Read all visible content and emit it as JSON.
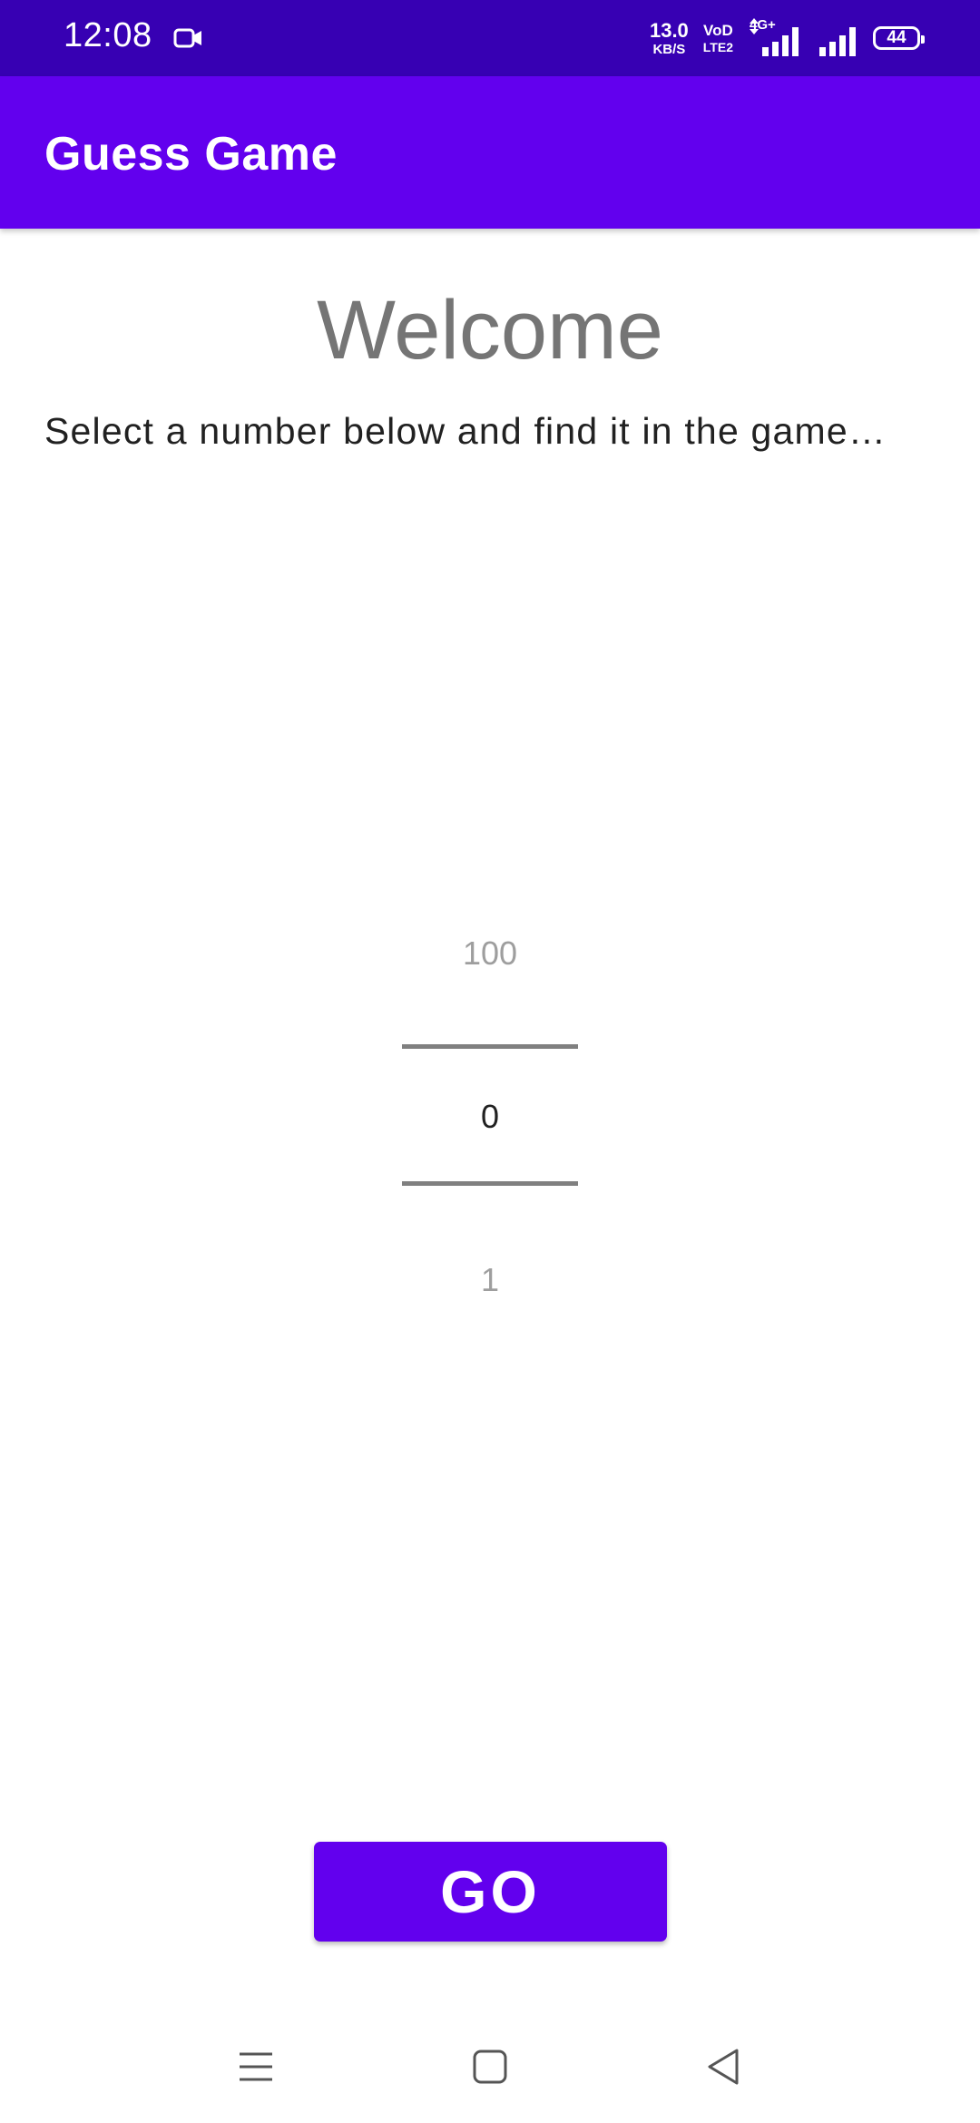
{
  "status_bar": {
    "time": "12:08",
    "net_speed_value": "13.0",
    "net_speed_unit": "KB/S",
    "volte_top": "VoD",
    "volte_bottom": "LTE2",
    "network_type": "4G+",
    "battery": "44",
    "icons": [
      "video-camera-icon",
      "signal-4g-icon",
      "signal-bars-icon",
      "battery-icon"
    ]
  },
  "app_bar": {
    "title": "Guess Game",
    "color": "#6200ee"
  },
  "main": {
    "heading": "Welcome",
    "instruction": "Select a number below and find it in the game…"
  },
  "picker": {
    "previous": "100",
    "current": "0",
    "next": "1"
  },
  "go_button": {
    "label": "GO",
    "color": "#6200ee"
  },
  "nav_bar": {
    "icons": [
      "menu-icon",
      "home-icon",
      "back-icon"
    ]
  },
  "colors": {
    "status_bar": "#3700b3",
    "accent": "#6200ee"
  }
}
